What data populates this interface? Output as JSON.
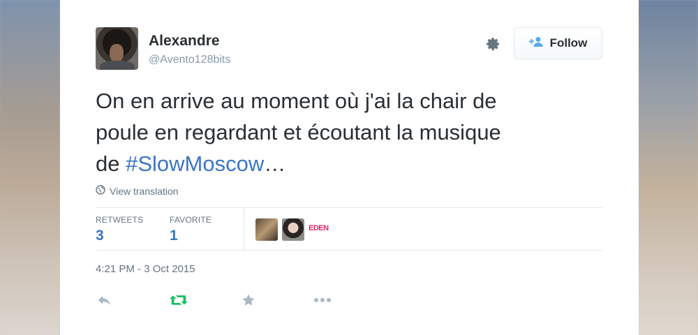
{
  "user": {
    "name": "Alexandre",
    "handle": "@Avento128bits"
  },
  "follow_button": {
    "label": "Follow"
  },
  "tweet": {
    "text_line1": "On en arrive au moment où j'ai la chair de",
    "text_line2": "poule en regardant et écoutant la musique",
    "text_line3_prefix": "de ",
    "hashtag": "#SlowMoscow",
    "text_line3_suffix": "…"
  },
  "translate": {
    "label": "View translation"
  },
  "stats": {
    "retweets_label": "RETWEETS",
    "retweets_value": "3",
    "favorites_label": "FAVORITE",
    "favorites_value": "1"
  },
  "favoriters": {
    "third_logo_text": "EDEN"
  },
  "timestamp": "4:21 PM - 3 Oct 2015",
  "colors": {
    "link": "#3b75c4",
    "text": "#292f33",
    "muted": "#66757f",
    "retweet_green": "#17bf63",
    "icon_gray": "#aab8c2"
  },
  "icons": {
    "gear": "gear-icon",
    "follow": "add-user-icon",
    "globe": "globe-icon",
    "reply": "reply-icon",
    "retweet": "retweet-icon",
    "favorite": "star-icon",
    "more": "more-icon"
  }
}
